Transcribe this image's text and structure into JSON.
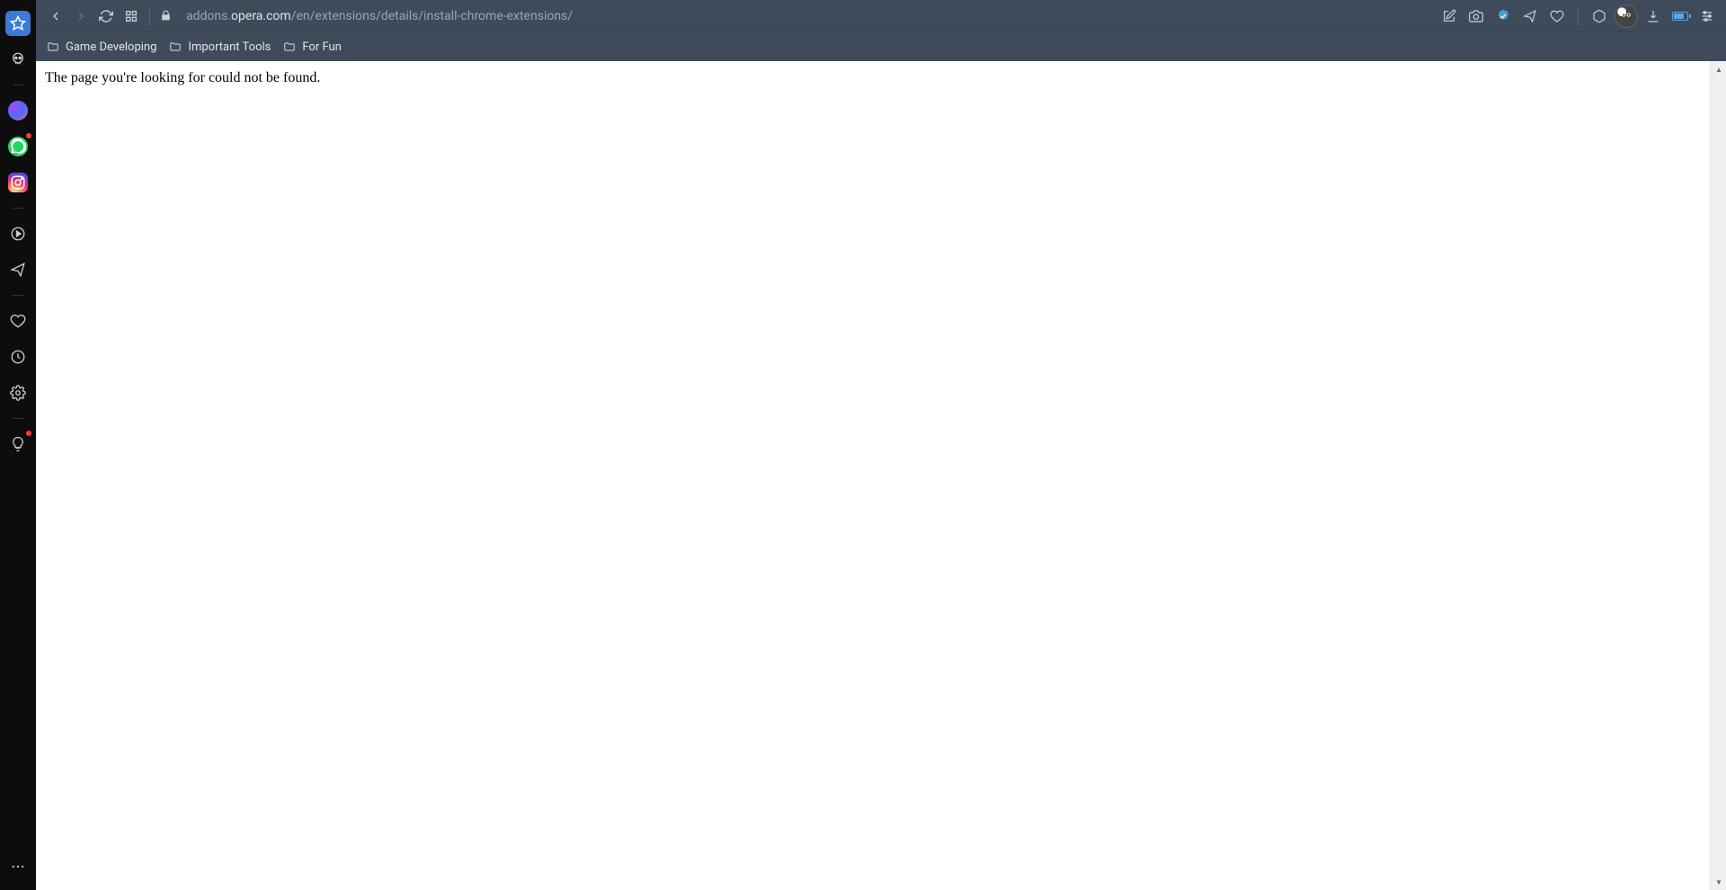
{
  "url": {
    "subdomain": "addons.",
    "domain": "opera.com",
    "path": "/en/extensions/details/install-chrome-extensions/"
  },
  "bookmarks": [
    {
      "label": "Game Developing"
    },
    {
      "label": "Important Tools"
    },
    {
      "label": "For Fun"
    }
  ],
  "page": {
    "error_message": "The page you're looking for could not be found."
  },
  "sidebar": {
    "items": [
      {
        "name": "star",
        "active": true
      },
      {
        "name": "skull"
      },
      {
        "name": "messenger",
        "notification": false
      },
      {
        "name": "whatsapp",
        "notification": true
      },
      {
        "name": "instagram"
      },
      {
        "name": "player"
      },
      {
        "name": "send"
      },
      {
        "name": "heart"
      },
      {
        "name": "history"
      },
      {
        "name": "settings"
      },
      {
        "name": "bulb",
        "notification": true
      }
    ]
  }
}
